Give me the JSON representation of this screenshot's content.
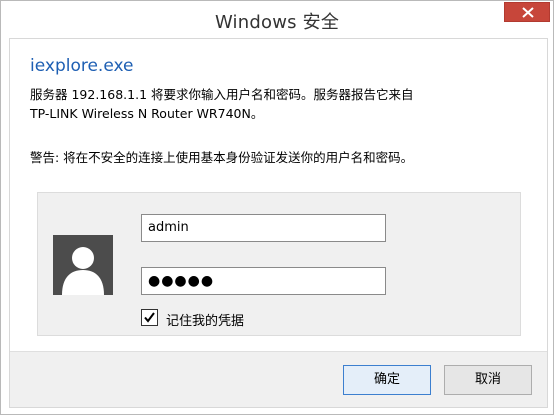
{
  "window": {
    "title": "Windows 安全"
  },
  "dialog": {
    "app_name": "iexplore.exe",
    "message_line1": "服务器 192.168.1.1 将要求你输入用户名和密码。服务器报告它来自",
    "message_line2": "TP-LINK Wireless N Router WR740N。",
    "warning": "警告: 将在不安全的连接上使用基本身份验证发送你的用户名和密码。"
  },
  "credentials": {
    "username_value": "admin",
    "password_value": "●●●●●",
    "remember_checked": true,
    "remember_label": "记住我的凭据"
  },
  "buttons": {
    "ok_label": "确定",
    "cancel_label": "取消"
  },
  "icons": {
    "close": "close-icon",
    "avatar": "user-avatar-icon",
    "check": "checkmark-icon"
  },
  "colors": {
    "close_button": "#c7463a",
    "app_name": "#1e5fb3",
    "avatar_bg": "#4c4c4c",
    "default_button_border": "#3c7fcf"
  }
}
